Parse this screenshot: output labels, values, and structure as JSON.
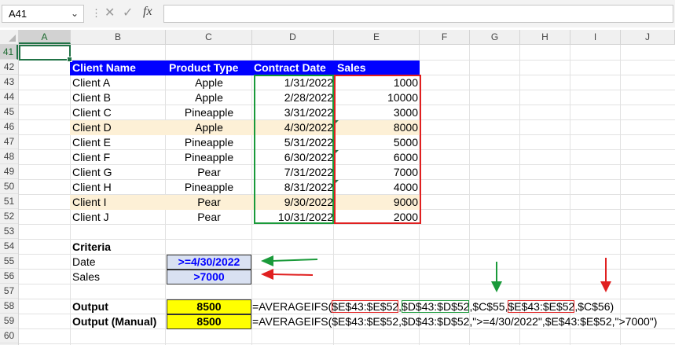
{
  "formula_bar": {
    "name_box": "A41",
    "fx_label": "fx",
    "formula": ""
  },
  "columns": [
    "A",
    "B",
    "C",
    "D",
    "E",
    "F",
    "G",
    "H",
    "I",
    "J"
  ],
  "rows": [
    "41",
    "42",
    "43",
    "44",
    "45",
    "46",
    "47",
    "48",
    "49",
    "50",
    "51",
    "52",
    "53",
    "54",
    "55",
    "56",
    "57",
    "58",
    "59",
    "60"
  ],
  "table": {
    "headers": [
      "Client Name",
      "Product Type",
      "Contract Date",
      "Sales"
    ],
    "rows": [
      [
        "Client A",
        "Apple",
        "1/31/2022",
        "1000"
      ],
      [
        "Client B",
        "Apple",
        "2/28/2022",
        "10000"
      ],
      [
        "Client C",
        "Pineapple",
        "3/31/2022",
        "3000"
      ],
      [
        "Client D",
        "Apple",
        "4/30/2022",
        "8000"
      ],
      [
        "Client E",
        "Pineapple",
        "5/31/2022",
        "5000"
      ],
      [
        "Client F",
        "Pineapple",
        "6/30/2022",
        "6000"
      ],
      [
        "Client G",
        "Pear",
        "7/31/2022",
        "7000"
      ],
      [
        "Client H",
        "Pineapple",
        "8/31/2022",
        "4000"
      ],
      [
        "Client I",
        "Pear",
        "9/30/2022",
        "9000"
      ],
      [
        "Client J",
        "Pear",
        "10/31/2022",
        "2000"
      ]
    ],
    "highlighted_rows": [
      3,
      8
    ]
  },
  "criteria": {
    "title": "Criteria",
    "date_label": "Date",
    "date_value": ">=4/30/2022",
    "sales_label": "Sales",
    "sales_value": ">7000"
  },
  "output": {
    "label": "Output",
    "value": "8500",
    "formula_parts": [
      "=AVERAGEIFS(",
      "$E$43:$E$52",
      ",",
      "$D$43:$D$52",
      ",$C$55,",
      "$E$43:$E$52",
      ",$C$56)"
    ],
    "manual_label": "Output (Manual)",
    "manual_value": "8500",
    "manual_formula": "=AVERAGEIFS($E$43:$E$52,$D$43:$D$52,\">=4/30/2022\",$E$43:$E$52,\">7000\")"
  },
  "colors": {
    "header_blue": "#0000ff",
    "band": "#fdf0d6",
    "green": "#1a9a3a",
    "red": "#e02020",
    "yellow": "#ffff00",
    "criteria_fill": "#d9e1f2"
  }
}
